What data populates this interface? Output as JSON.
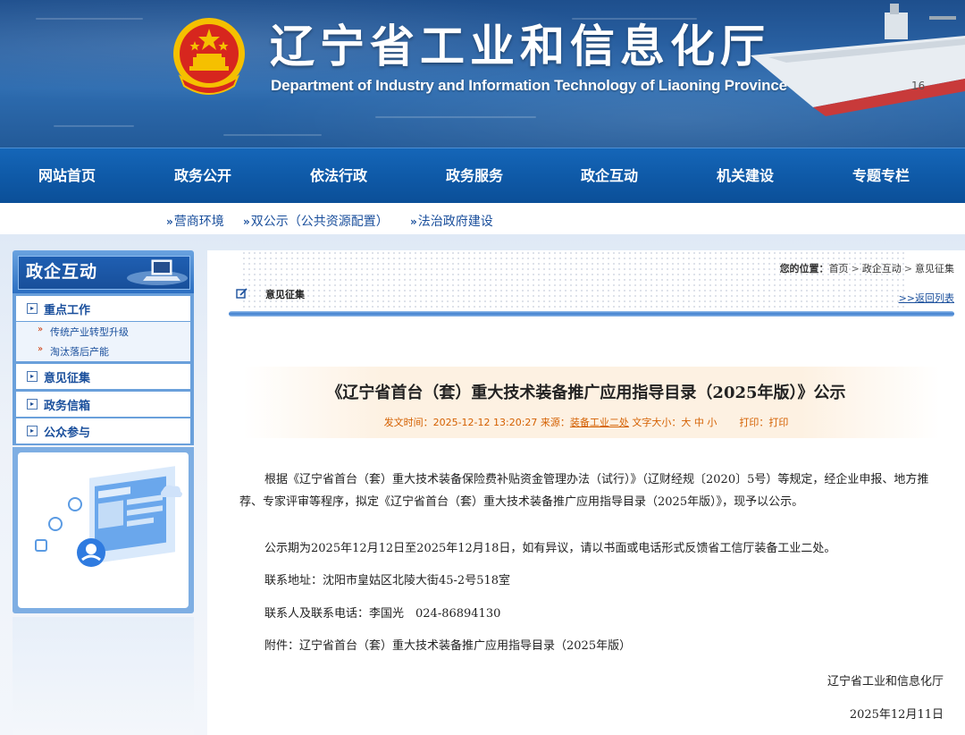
{
  "header": {
    "title": "辽宁省工业和信息化厅",
    "subtitle": "Department of Industry and Information Technology of Liaoning Province"
  },
  "nav": [
    "网站首页",
    "政务公开",
    "依法行政",
    "政务服务",
    "政企互动",
    "机关建设",
    "专题专栏"
  ],
  "sublinks": [
    "营商环境",
    "双公示（公共资源配置）",
    "法治政府建设"
  ],
  "sidebar": {
    "title": "政企互动",
    "items": [
      {
        "label": "重点工作",
        "subitems": [
          "传统产业转型升级",
          "淘汰落后产能"
        ]
      },
      {
        "label": "意见征集"
      },
      {
        "label": "政务信箱"
      },
      {
        "label": "公众参与"
      }
    ]
  },
  "breadcrumb": {
    "prefix": "您的位置：",
    "items": [
      "首页",
      "政企互动",
      "意见征集"
    ],
    "separator": ">"
  },
  "section": {
    "name": "意见征集",
    "back_link": ">>返回列表"
  },
  "article": {
    "title": "《辽宁省首台（套）重大技术装备推广应用指导目录（2025年版）》公示",
    "meta": {
      "date_label": "发文时间：",
      "date": "2025-12-12 13:20:27",
      "source_label": "来源：",
      "source": "装备工业二处",
      "fontsize_label": "文字大小：",
      "font_sizes": [
        "大",
        "中",
        "小"
      ],
      "print_label": "打印：",
      "print": "打印"
    },
    "paragraphs": [
      "根据《辽宁省首台（套）重大技术装备保险费补贴资金管理办法（试行）》（辽财经规〔2020〕5号）等规定，经企业申报、地方推荐、专家评审等程序，拟定《辽宁省首台（套）重大技术装备推广应用指导目录（2025年版）》，现予以公示。",
      "公示期为2025年12月12日至2025年12月18日，如有异议，请以书面或电话形式反馈省工信厅装备工业二处。",
      "联系地址：沈阳市皇姑区北陵大街45-2号518室",
      "联系人及联系电话：李国光　024-86894130",
      "附件：辽宁省首台（套）重大技术装备推广应用指导目录（2025年版）"
    ],
    "signature": "辽宁省工业和信息化厅",
    "sign_date": "2025年12月11日"
  },
  "colors": {
    "nav_blue": "#0f5aa8",
    "link_blue": "#1a4f9c",
    "meta_orange": "#d46000",
    "emblem_red": "#d7261e",
    "emblem_gold": "#f5c000"
  }
}
